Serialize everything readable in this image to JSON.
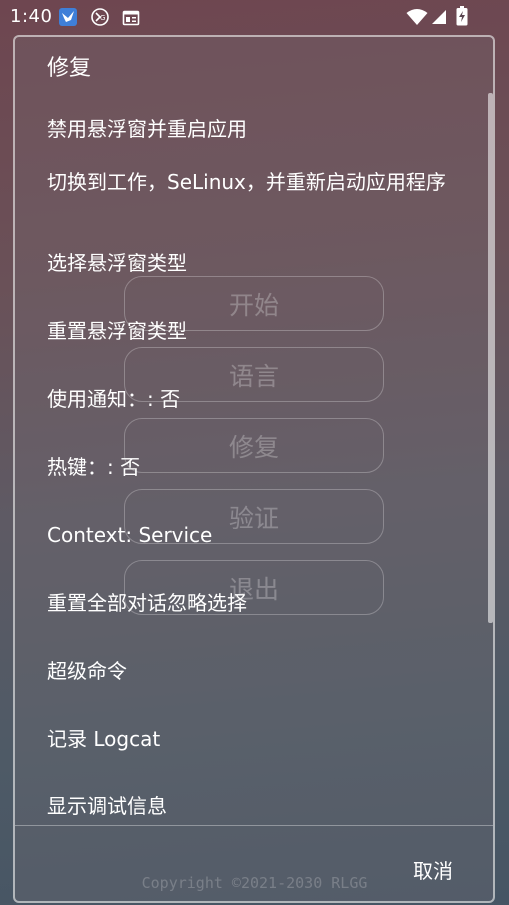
{
  "status_bar": {
    "time": "1:40",
    "icons": [
      "bird-app-icon",
      "gg-app-icon",
      "news-icon",
      "wifi-icon",
      "cell-signal-icon",
      "battery-charging-icon"
    ]
  },
  "background": {
    "buttons": [
      {
        "label": "开始"
      },
      {
        "label": "语言"
      },
      {
        "label": "修复"
      },
      {
        "label": "验证"
      },
      {
        "label": "退出"
      }
    ],
    "copyright": "Copyright ©2021-2030 RLGG"
  },
  "dialog": {
    "title": "修复",
    "items": [
      {
        "label": "禁用悬浮窗并重启应用"
      },
      {
        "label": "切换到工作，SeLinux，并重新启动应用程序"
      },
      {
        "label": "选择悬浮窗类型"
      },
      {
        "label": "重置悬浮窗类型"
      },
      {
        "label": "使用通知：: 否"
      },
      {
        "label": "热键：: 否"
      },
      {
        "label": "Context: Service"
      },
      {
        "label": "重置全部对话忽略选择"
      },
      {
        "label": "超级命令"
      },
      {
        "label": "记录 Logcat"
      },
      {
        "label": "显示调试信息"
      }
    ],
    "cancel_label": "取消"
  }
}
